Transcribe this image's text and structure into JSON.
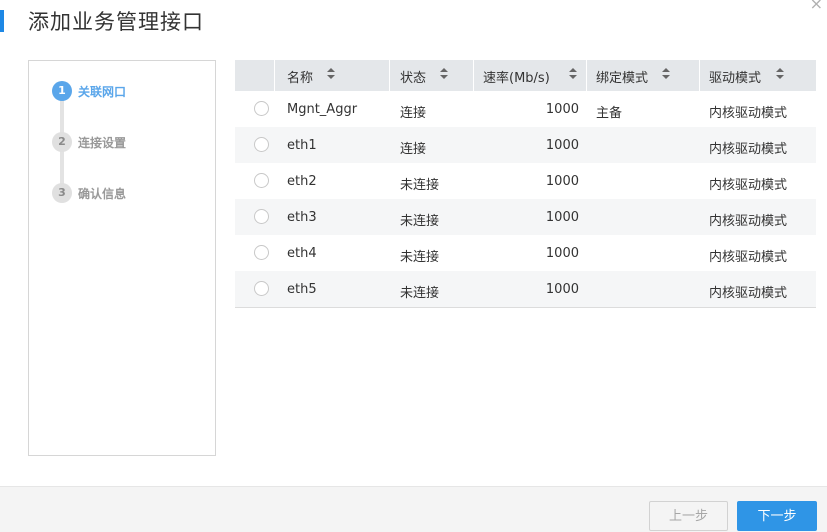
{
  "dialog": {
    "title": "添加业务管理接口",
    "close_symbol": "×"
  },
  "steps": [
    {
      "num": "1",
      "label": "关联网口",
      "active": true
    },
    {
      "num": "2",
      "label": "连接设置",
      "active": false
    },
    {
      "num": "3",
      "label": "确认信息",
      "active": false
    }
  ],
  "table": {
    "headers": [
      "名称",
      "状态",
      "速率(Mb/s)",
      "绑定模式",
      "驱动模式"
    ],
    "rows": [
      [
        "Mgnt_Aggr",
        "连接",
        "1000",
        "主备",
        "内核驱动模式"
      ],
      [
        "eth1",
        "连接",
        "1000",
        "",
        "内核驱动模式"
      ],
      [
        "eth2",
        "未连接",
        "1000",
        "",
        "内核驱动模式"
      ],
      [
        "eth3",
        "未连接",
        "1000",
        "",
        "内核驱动模式"
      ],
      [
        "eth4",
        "未连接",
        "1000",
        "",
        "内核驱动模式"
      ],
      [
        "eth5",
        "未连接",
        "1000",
        "",
        "内核驱动模式"
      ]
    ]
  },
  "footer": {
    "prev_label": "上一步",
    "next_label": "下一步"
  },
  "colors": {
    "accent": "#1e88e5",
    "active_step": "#5aa6ea",
    "primary_button": "#2f95e6"
  }
}
